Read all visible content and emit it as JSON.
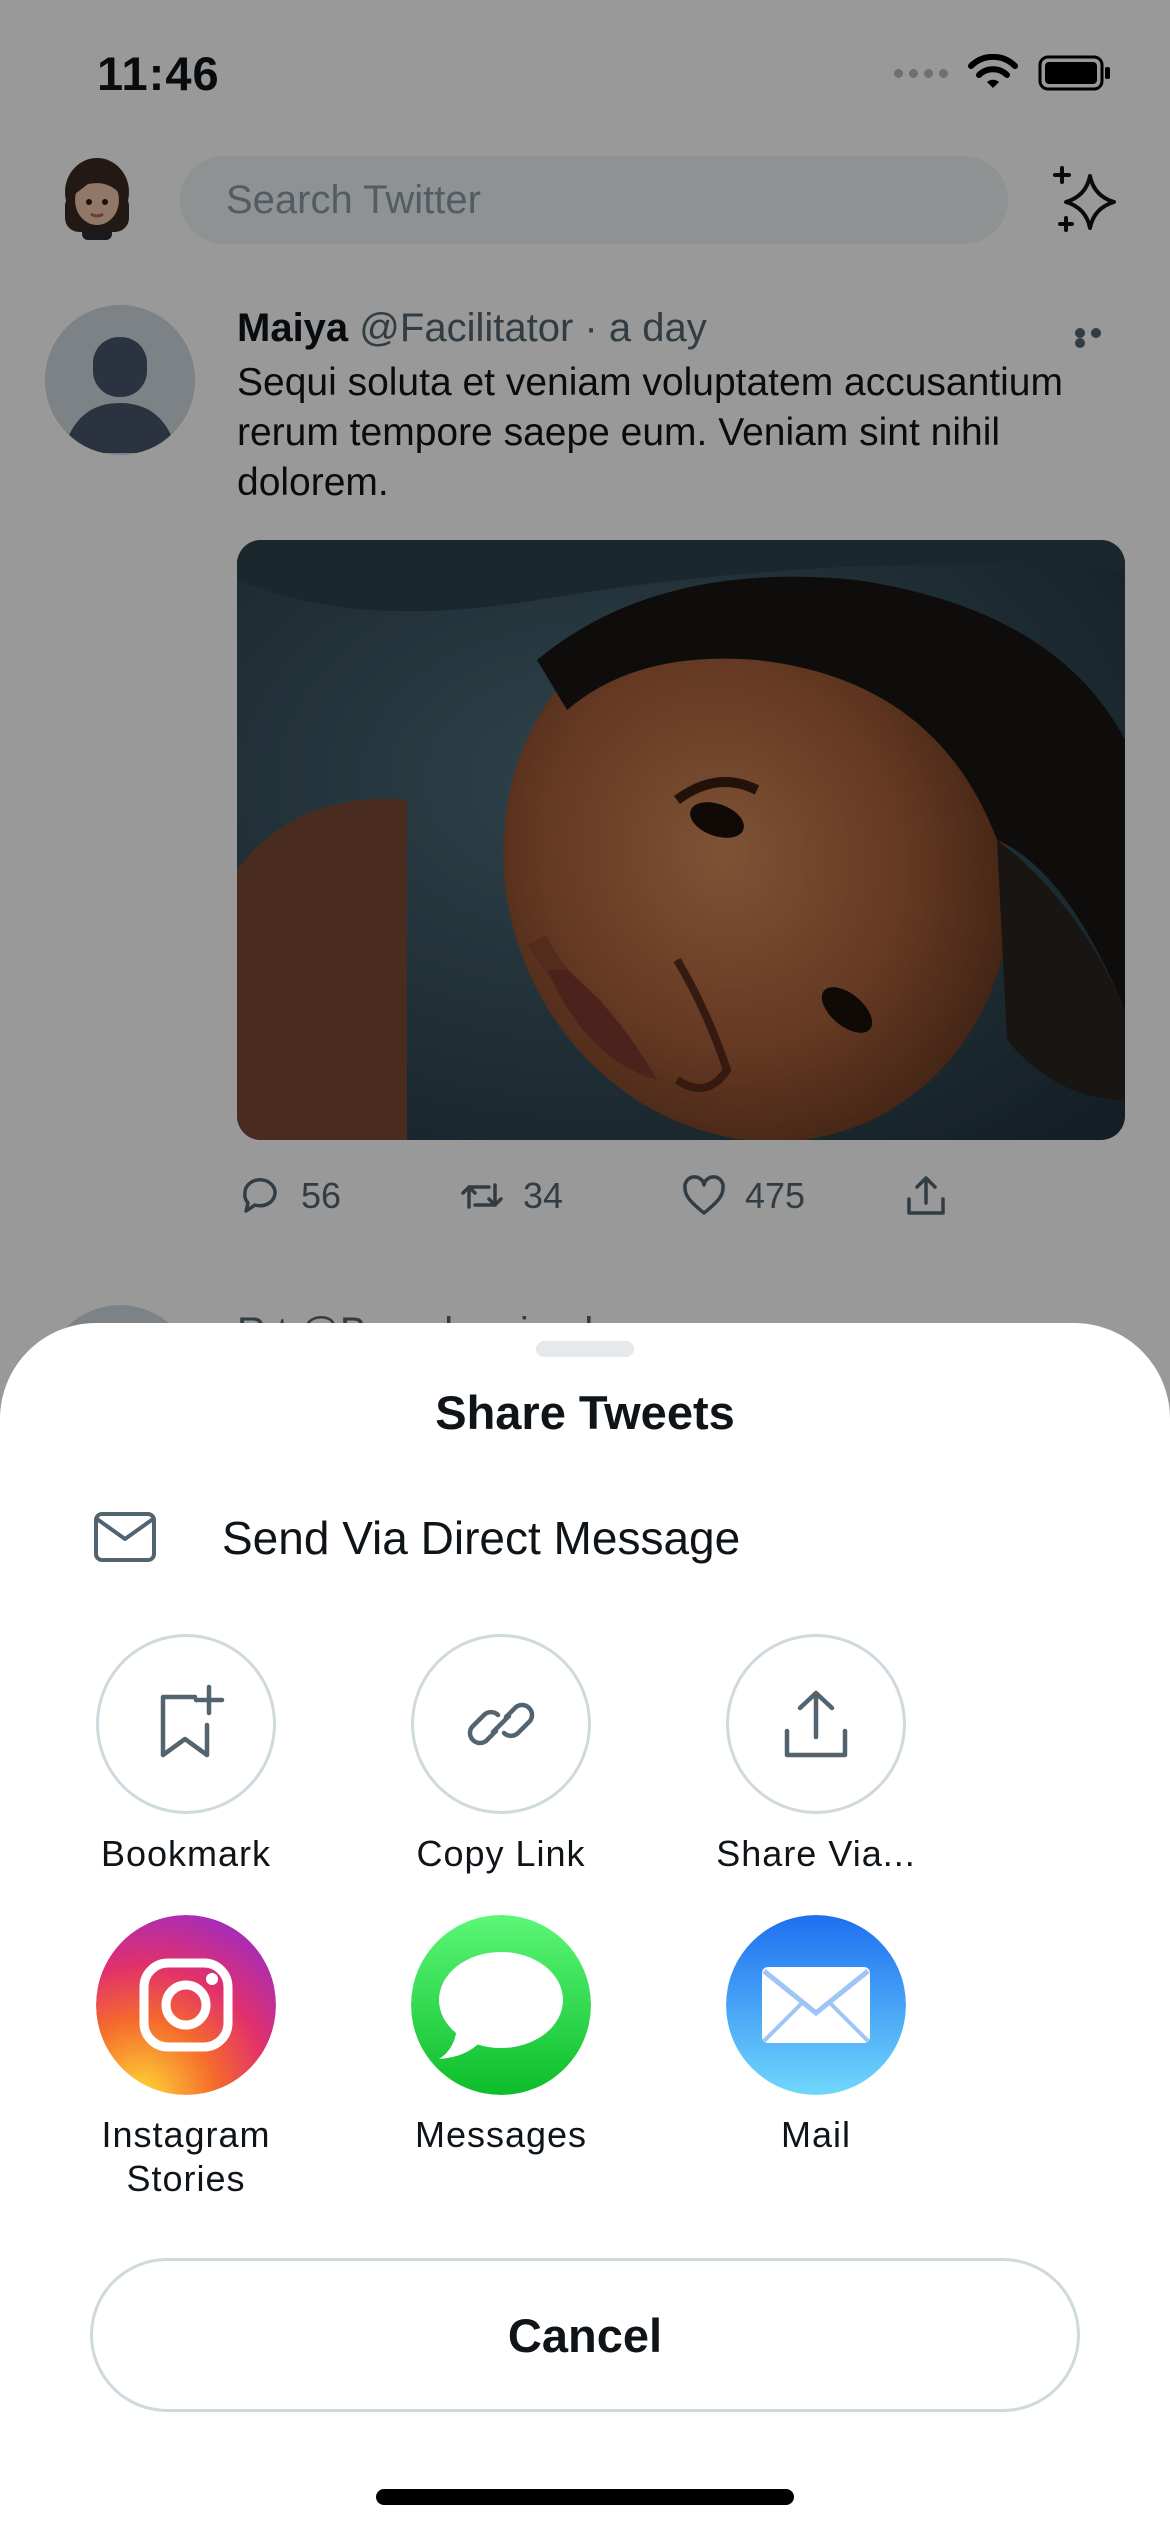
{
  "status_bar": {
    "time": "11:46"
  },
  "header": {
    "search_placeholder": "Search Twitter"
  },
  "tweet": {
    "name": "Maiya",
    "handle": "@Facilitator",
    "time": "· a day",
    "text": "Sequi soluta et veniam voluptatem accusantium rerum tempore saepe eum. Veniam sint nihil dolorem.",
    "replies": "56",
    "retweets": "34",
    "likes": "475"
  },
  "next_tweet": {
    "partial_text": "R.t @B... ...l.. ...i... .l"
  },
  "share_sheet": {
    "title": "Share Tweets",
    "direct_message_label": "Send Via Direct Message",
    "options": [
      {
        "label": "Bookmark",
        "icon": "bookmark-add-icon"
      },
      {
        "label": "Copy Link",
        "icon": "link-icon"
      },
      {
        "label": "Share Via...",
        "icon": "share-upload-icon"
      }
    ],
    "apps": [
      {
        "label": "Instagram Stories",
        "line1": "Instagram",
        "line2": "Stories",
        "icon": "instagram-icon"
      },
      {
        "label": "Messages",
        "icon": "messages-icon"
      },
      {
        "label": "Mail",
        "icon": "mail-icon"
      }
    ],
    "cancel_label": "Cancel"
  },
  "colors": {
    "accent": "#1d9bf0",
    "text_primary": "#0f1419",
    "text_secondary": "#536471",
    "border": "#cfd9de",
    "overlay": "rgba(0,0,0,0.40)"
  }
}
